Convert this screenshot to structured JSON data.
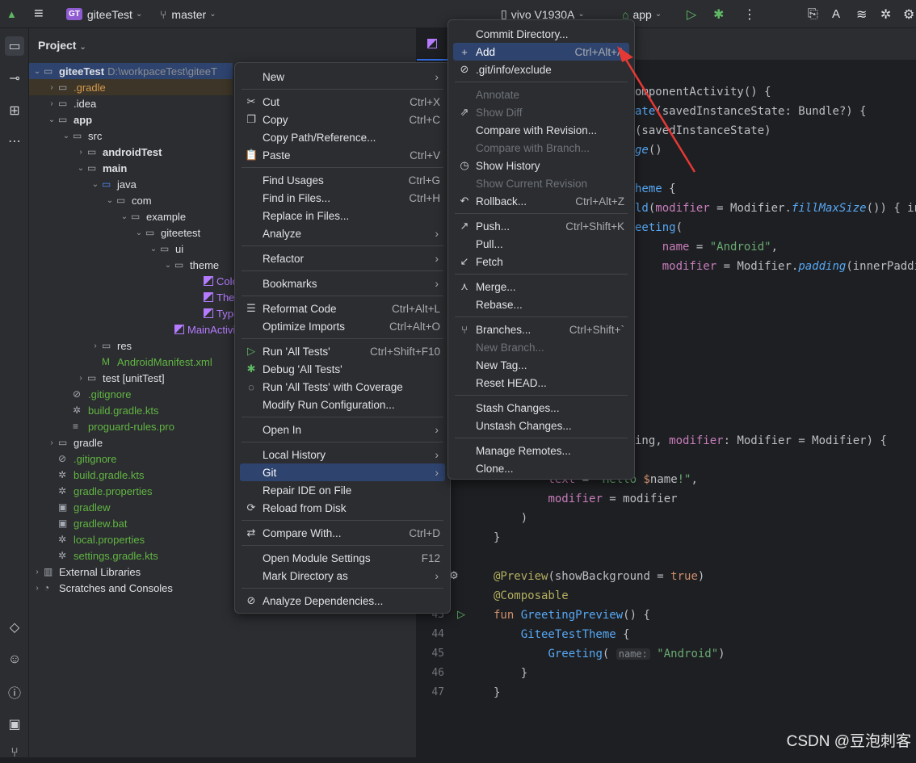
{
  "titlebar": {
    "project_badge": "GT",
    "project": "giteeTest",
    "branch": "master",
    "device": "vivo V1930A",
    "run_config": "app"
  },
  "project_panel": {
    "title": "Project",
    "tree": [
      {
        "label": "giteeTest",
        "extra": "D:\\workpaceTest\\giteeT",
        "indent": 0,
        "arrow": "v",
        "type": "module",
        "bold": true
      },
      {
        "label": ".gradle",
        "indent": 1,
        "arrow": ">",
        "type": "folder",
        "cls": "or"
      },
      {
        "label": ".idea",
        "indent": 1,
        "arrow": ">",
        "type": "folder"
      },
      {
        "label": "app",
        "indent": 1,
        "arrow": "v",
        "type": "module",
        "bold": true
      },
      {
        "label": "src",
        "indent": 2,
        "arrow": "v",
        "type": "folder"
      },
      {
        "label": "androidTest",
        "indent": 3,
        "arrow": ">",
        "type": "folder",
        "bold": true
      },
      {
        "label": "main",
        "indent": 3,
        "arrow": "v",
        "type": "folder",
        "bold": true
      },
      {
        "label": "java",
        "indent": 4,
        "arrow": "v",
        "type": "folder"
      },
      {
        "label": "com",
        "indent": 5,
        "arrow": "v",
        "type": "pkg"
      },
      {
        "label": "example",
        "indent": 6,
        "arrow": "v",
        "type": "pkg"
      },
      {
        "label": "giteetest",
        "indent": 7,
        "arrow": "v",
        "type": "pkg"
      },
      {
        "label": "ui",
        "indent": 8,
        "arrow": "v",
        "type": "pkg"
      },
      {
        "label": "theme",
        "indent": 9,
        "arrow": "v",
        "type": "pkg"
      },
      {
        "label": "Color",
        "indent": 11,
        "arrow": "",
        "type": "kt",
        "cls": "kt2"
      },
      {
        "label": "Them",
        "indent": 11,
        "arrow": "",
        "type": "kt",
        "cls": "kt2"
      },
      {
        "label": "Type.",
        "indent": 11,
        "arrow": "",
        "type": "kt",
        "cls": "kt2"
      },
      {
        "label": "MainActivit",
        "indent": 9,
        "arrow": "",
        "type": "kt",
        "cls": "kt2"
      },
      {
        "label": "res",
        "indent": 4,
        "arrow": ">",
        "type": "folder"
      },
      {
        "label": "AndroidManifest.xml",
        "indent": 4,
        "arrow": "",
        "type": "manifest",
        "cls": "gr"
      },
      {
        "label": "test [unitTest]",
        "indent": 3,
        "arrow": ">",
        "type": "folder"
      },
      {
        "label": ".gitignore",
        "indent": 2,
        "arrow": "",
        "type": "ignore",
        "cls": "gr"
      },
      {
        "label": "build.gradle.kts",
        "indent": 2,
        "arrow": "",
        "type": "gradle",
        "cls": "gr"
      },
      {
        "label": "proguard-rules.pro",
        "indent": 2,
        "arrow": "",
        "type": "text",
        "cls": "gr"
      },
      {
        "label": "gradle",
        "indent": 1,
        "arrow": ">",
        "type": "folder"
      },
      {
        "label": ".gitignore",
        "indent": 1,
        "arrow": "",
        "type": "ignore",
        "cls": "gr"
      },
      {
        "label": "build.gradle.kts",
        "indent": 1,
        "arrow": "",
        "type": "gradle",
        "cls": "gr"
      },
      {
        "label": "gradle.properties",
        "indent": 1,
        "arrow": "",
        "type": "settings",
        "cls": "gr"
      },
      {
        "label": "gradlew",
        "indent": 1,
        "arrow": "",
        "type": "script",
        "cls": "gr"
      },
      {
        "label": "gradlew.bat",
        "indent": 1,
        "arrow": "",
        "type": "script",
        "cls": "gr"
      },
      {
        "label": "local.properties",
        "indent": 1,
        "arrow": "",
        "type": "settings",
        "cls": "gr"
      },
      {
        "label": "settings.gradle.kts",
        "indent": 1,
        "arrow": "",
        "type": "gradle",
        "cls": "gr"
      },
      {
        "label": "External Libraries",
        "indent": 0,
        "arrow": ">",
        "type": "lib"
      },
      {
        "label": "Scratches and Consoles",
        "indent": 0,
        "arrow": ">",
        "type": "scratch"
      }
    ]
  },
  "editor": {
    "line_numbers": [
      "43",
      "44",
      "45",
      "46",
      "47"
    ],
    "hint": "name:"
  },
  "context_menu": [
    {
      "label": "New",
      "sub": true
    },
    {
      "sep": true
    },
    {
      "label": "Cut",
      "shortcut": "Ctrl+X",
      "icon": "✂"
    },
    {
      "label": "Copy",
      "shortcut": "Ctrl+C",
      "icon": "❐"
    },
    {
      "label": "Copy Path/Reference..."
    },
    {
      "label": "Paste",
      "shortcut": "Ctrl+V",
      "icon": "📋"
    },
    {
      "sep": true
    },
    {
      "label": "Find Usages",
      "shortcut": "Ctrl+G"
    },
    {
      "label": "Find in Files...",
      "shortcut": "Ctrl+H"
    },
    {
      "label": "Replace in Files..."
    },
    {
      "label": "Analyze",
      "sub": true
    },
    {
      "sep": true
    },
    {
      "label": "Refactor",
      "sub": true
    },
    {
      "sep": true
    },
    {
      "label": "Bookmarks",
      "sub": true
    },
    {
      "sep": true
    },
    {
      "label": "Reformat Code",
      "shortcut": "Ctrl+Alt+L",
      "icon": "☰"
    },
    {
      "label": "Optimize Imports",
      "shortcut": "Ctrl+Alt+O"
    },
    {
      "sep": true
    },
    {
      "label": "Run 'All Tests'",
      "shortcut": "Ctrl+Shift+F10",
      "icon": "▷",
      "iconColor": "#5fb865"
    },
    {
      "label": "Debug 'All Tests'",
      "icon": "✱",
      "iconColor": "#5fb865"
    },
    {
      "label": "Run 'All Tests' with Coverage",
      "icon": "◌"
    },
    {
      "label": "Modify Run Configuration..."
    },
    {
      "sep": true
    },
    {
      "label": "Open In",
      "sub": true
    },
    {
      "sep": true
    },
    {
      "label": "Local History",
      "sub": true
    },
    {
      "label": "Git",
      "sub": true,
      "selected": true
    },
    {
      "label": "Repair IDE on File"
    },
    {
      "label": "Reload from Disk",
      "icon": "⟳"
    },
    {
      "sep": true
    },
    {
      "label": "Compare With...",
      "shortcut": "Ctrl+D",
      "icon": "⇄"
    },
    {
      "sep": true
    },
    {
      "label": "Open Module Settings",
      "shortcut": "F12"
    },
    {
      "label": "Mark Directory as",
      "sub": true
    },
    {
      "sep": true
    },
    {
      "label": "Analyze Dependencies...",
      "icon": "⊘"
    }
  ],
  "git_menu": [
    {
      "label": "Commit Directory..."
    },
    {
      "label": "Add",
      "shortcut": "Ctrl+Alt+A",
      "icon": "+",
      "selected": true
    },
    {
      "label": ".git/info/exclude",
      "icon": "⊘"
    },
    {
      "sep": true
    },
    {
      "label": "Annotate",
      "disabled": true
    },
    {
      "label": "Show Diff",
      "disabled": true,
      "icon": "⇗"
    },
    {
      "label": "Compare with Revision..."
    },
    {
      "label": "Compare with Branch...",
      "disabled": true
    },
    {
      "label": "Show History",
      "icon": "◷"
    },
    {
      "label": "Show Current Revision",
      "disabled": true
    },
    {
      "label": "Rollback...",
      "shortcut": "Ctrl+Alt+Z",
      "icon": "↶"
    },
    {
      "sep": true
    },
    {
      "label": "Push...",
      "shortcut": "Ctrl+Shift+K",
      "icon": "↗"
    },
    {
      "label": "Pull..."
    },
    {
      "label": "Fetch",
      "icon": "↙"
    },
    {
      "sep": true
    },
    {
      "label": "Merge...",
      "icon": "⋏"
    },
    {
      "label": "Rebase..."
    },
    {
      "sep": true
    },
    {
      "label": "Branches...",
      "shortcut": "Ctrl+Shift+`",
      "icon": "⑂"
    },
    {
      "label": "New Branch...",
      "disabled": true
    },
    {
      "label": "New Tag..."
    },
    {
      "label": "Reset HEAD..."
    },
    {
      "sep": true
    },
    {
      "label": "Stash Changes..."
    },
    {
      "label": "Unstash Changes..."
    },
    {
      "sep": true
    },
    {
      "label": "Manage Remotes..."
    },
    {
      "label": "Clone..."
    }
  ],
  "watermark": "CSDN @豆泡刺客"
}
